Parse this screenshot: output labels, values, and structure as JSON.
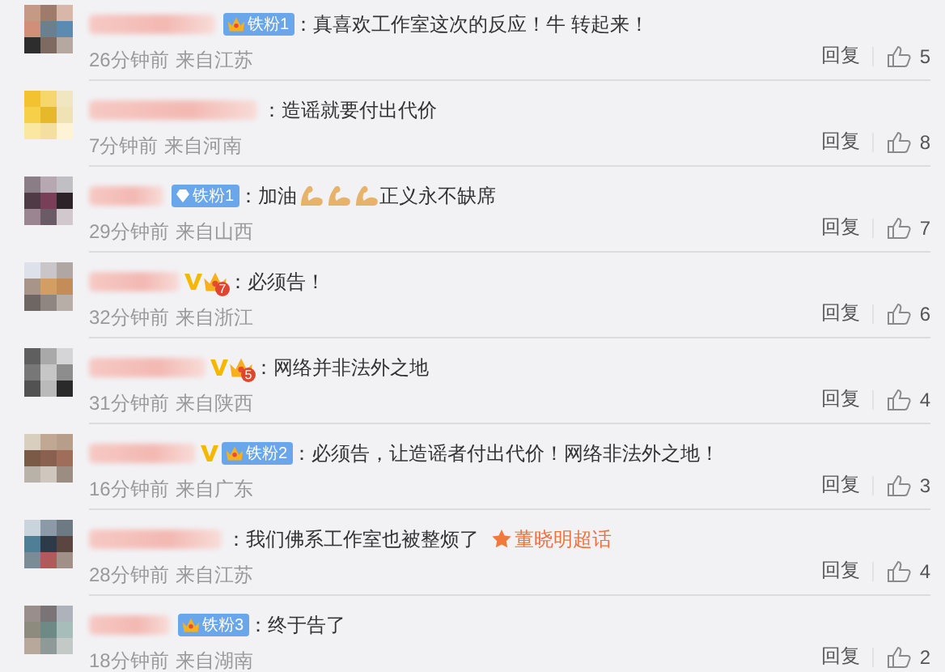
{
  "comments": [
    {
      "verified": false,
      "badge": {
        "kind": "fan",
        "label": "铁粉1"
      },
      "content": [
        {
          "kind": "text",
          "value": "：真喜欢工作室这次的反应！牛 转起来！"
        }
      ],
      "time": "26分钟前",
      "location": "来自江苏",
      "reply": "回复",
      "likes": "5"
    },
    {
      "verified": false,
      "content": [
        {
          "kind": "text",
          "value": "：造谣就要付出代价"
        }
      ],
      "time": "7分钟前",
      "location": "来自河南",
      "reply": "回复",
      "likes": "8"
    },
    {
      "verified": false,
      "badge": {
        "kind": "diamond",
        "label": "铁粉1"
      },
      "content": [
        {
          "kind": "text",
          "value": "：加油"
        },
        {
          "kind": "emoji"
        },
        {
          "kind": "emoji"
        },
        {
          "kind": "emoji"
        },
        {
          "kind": "text",
          "value": "正义永不缺席"
        }
      ],
      "time": "29分钟前",
      "location": "来自山西",
      "reply": "回复",
      "likes": "7"
    },
    {
      "verified": true,
      "badge": {
        "kind": "level",
        "label": "7"
      },
      "content": [
        {
          "kind": "text",
          "value": "：必须告！"
        }
      ],
      "time": "32分钟前",
      "location": "来自浙江",
      "reply": "回复",
      "likes": "6"
    },
    {
      "verified": true,
      "badge": {
        "kind": "level",
        "label": "5"
      },
      "content": [
        {
          "kind": "text",
          "value": "：网络并非法外之地"
        }
      ],
      "time": "31分钟前",
      "location": "来自陕西",
      "reply": "回复",
      "likes": "4"
    },
    {
      "verified": true,
      "badge": {
        "kind": "fan",
        "label": "铁粉2"
      },
      "content": [
        {
          "kind": "text",
          "value": "：必须告，让造谣者付出代价！网络非法外之地！"
        }
      ],
      "time": "16分钟前",
      "location": "来自广东",
      "reply": "回复",
      "likes": "3"
    },
    {
      "verified": false,
      "content": [
        {
          "kind": "text",
          "value": "：我们佛系工作室也被整烦了"
        },
        {
          "kind": "topic",
          "value": "董晓明超话"
        }
      ],
      "time": "28分钟前",
      "location": "来自江苏",
      "reply": "回复",
      "likes": "4"
    },
    {
      "verified": false,
      "badge": {
        "kind": "fan",
        "label": "铁粉3"
      },
      "content": [
        {
          "kind": "text",
          "value": "：终于告了"
        }
      ],
      "time": "18分钟前",
      "location": "来自湖南",
      "reply": "回复",
      "likes": "2"
    }
  ]
}
